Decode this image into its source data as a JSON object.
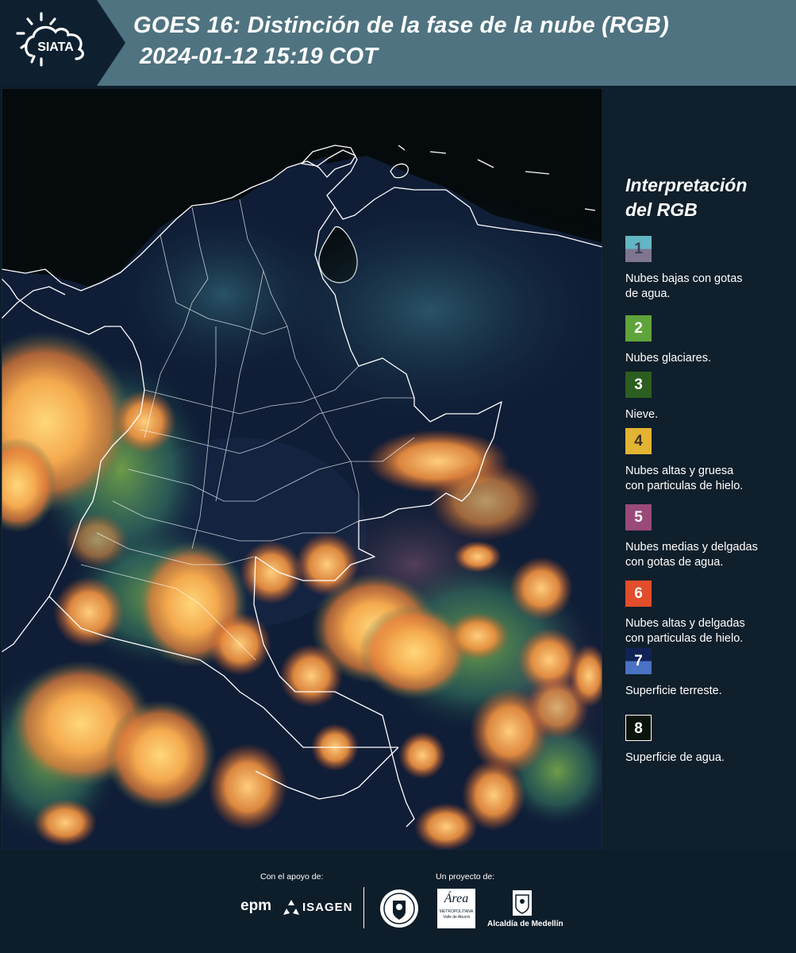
{
  "header": {
    "logo_text": "SIATA",
    "title_line1": "GOES 16: Distinción de la fase de la nube (RGB)",
    "title_line2": "2024-01-12 15:19 COT"
  },
  "legend": {
    "title_line1": "Interpretación",
    "title_line2": "del RGB",
    "items": [
      {
        "num": "1",
        "label_lines": [
          "Nubes bajas con gotas",
          "de agua."
        ],
        "color_top": "#63b7c4",
        "color_bottom": "#7f7590"
      },
      {
        "num": "2",
        "label_lines": [
          "Nubes glaciares."
        ],
        "color_top": "#5ea43a",
        "color_bottom": "#5ea43a"
      },
      {
        "num": "3",
        "label_lines": [
          "Nieve."
        ],
        "color_top": "#2c5e1f",
        "color_bottom": "#2c5e1f"
      },
      {
        "num": "4",
        "label_lines": [
          "Nubes altas y gruesa",
          "con particulas de hielo."
        ],
        "color_top": "#e3b332",
        "color_bottom": "#e3b332"
      },
      {
        "num": "5",
        "label_lines": [
          "Nubes medias y delgadas",
          "con gotas de agua."
        ],
        "color_top": "#9a4a78",
        "color_bottom": "#9a4a78"
      },
      {
        "num": "6",
        "label_lines": [
          "Nubes altas y delgadas",
          "con particulas de hielo."
        ],
        "color_top": "#e24d2b",
        "color_bottom": "#e24d2b"
      },
      {
        "num": "7",
        "label_lines": [
          "Superficie terreste."
        ],
        "color_top": "#112255",
        "color_bottom": "#4a72c4"
      },
      {
        "num": "8",
        "label_lines": [
          "Superficie de agua."
        ],
        "color_top": "#0a140a",
        "color_bottom": "#0a140a"
      }
    ]
  },
  "footer": {
    "support_label": "Con el apoyo de:",
    "project_label": "Un proyecto de:",
    "sponsor_epm": "epm",
    "sponsor_isagen": "ISAGEN",
    "area_logo_text": "Área",
    "area_sub1": "METROPOLITANA",
    "area_sub2": "Valle de Aburrá",
    "alcaldia": "Alcaldía de Medellín"
  }
}
